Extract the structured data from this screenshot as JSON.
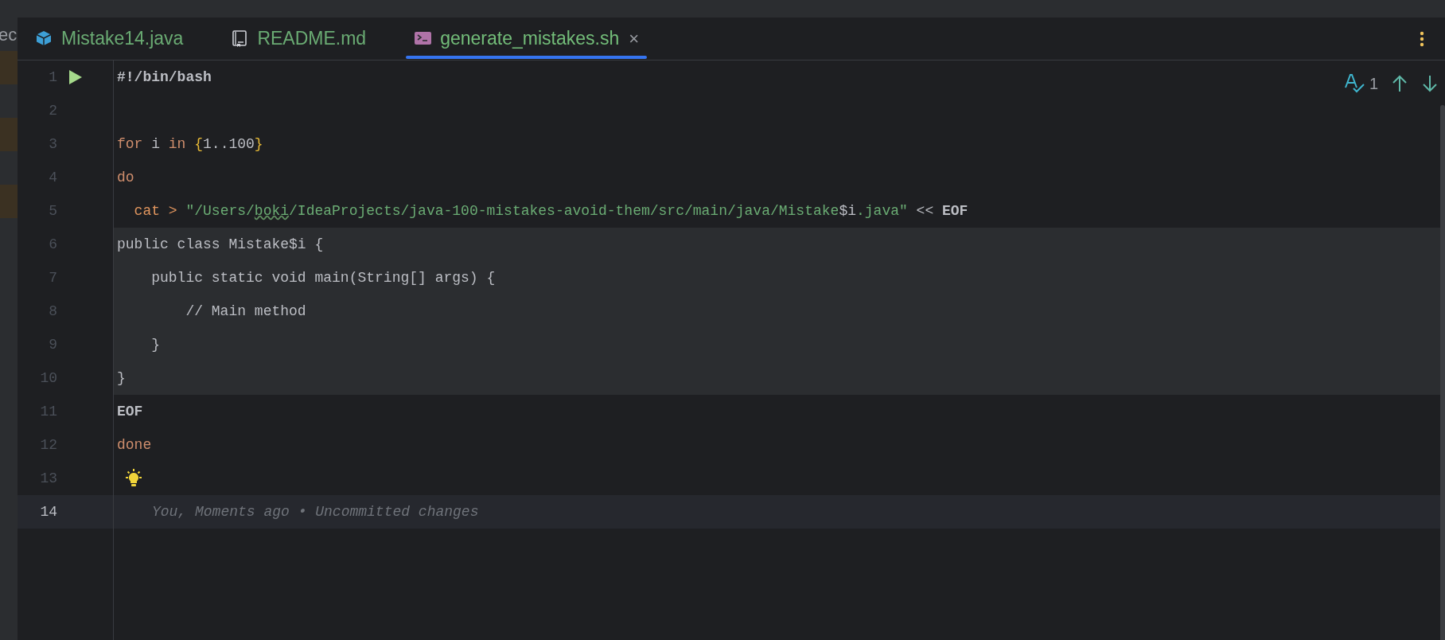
{
  "side_panel": {
    "clipped_text": "ec"
  },
  "tabs": [
    {
      "label": "Mistake14.java",
      "kind": "java",
      "selected": false
    },
    {
      "label": "README.md",
      "kind": "markdown",
      "selected": false
    },
    {
      "label": "generate_mistakes.sh",
      "kind": "shell",
      "selected": true,
      "close_glyph": "×"
    }
  ],
  "inspections": {
    "count": "1"
  },
  "lines": [
    {
      "number": "1",
      "run_marker": true,
      "tokens": [
        {
          "kind": "bold",
          "text": "#!/bin/bash"
        }
      ]
    },
    {
      "number": "2"
    },
    {
      "number": "3",
      "tokens": [
        {
          "kind": "keyword",
          "text": "for"
        },
        {
          "kind": "plain",
          "text": " i "
        },
        {
          "kind": "keyword",
          "text": "in"
        },
        {
          "kind": "brace",
          "text": " {"
        },
        {
          "kind": "plain",
          "text": "1..100"
        },
        {
          "kind": "brace",
          "text": "}"
        }
      ]
    },
    {
      "number": "4",
      "tokens": [
        {
          "kind": "keyword",
          "text": "do"
        }
      ]
    },
    {
      "number": "5",
      "tokens": [
        {
          "kind": "command",
          "text": "  cat > "
        },
        {
          "kind": "string",
          "text": "\"/Users/"
        },
        {
          "kind": "typo",
          "text": "boki"
        },
        {
          "kind": "string",
          "text": "/IdeaProjects/java-100-mistakes-avoid-them/src/main/java/Mistake"
        },
        {
          "kind": "plain",
          "text": "$i"
        },
        {
          "kind": "string",
          "text": ".java\""
        },
        {
          "kind": "plain",
          "text": " << "
        },
        {
          "kind": "bold",
          "text": "EOF"
        }
      ]
    },
    {
      "number": "6",
      "injected": true,
      "tokens": [
        {
          "kind": "plain",
          "text": "public class Mistake$i {"
        }
      ]
    },
    {
      "number": "7",
      "injected": true,
      "tokens": [
        {
          "kind": "plain",
          "text": "    public static void main(String[] args) {"
        }
      ]
    },
    {
      "number": "8",
      "injected": true,
      "tokens": [
        {
          "kind": "plain",
          "text": "        // Main method"
        }
      ]
    },
    {
      "number": "9",
      "injected": true,
      "tokens": [
        {
          "kind": "plain",
          "text": "    }"
        }
      ]
    },
    {
      "number": "10",
      "injected": true,
      "tokens": [
        {
          "kind": "plain",
          "text": "}"
        }
      ]
    },
    {
      "number": "11",
      "tokens": [
        {
          "kind": "bold",
          "text": "EOF"
        }
      ]
    },
    {
      "number": "12",
      "tokens": [
        {
          "kind": "keyword",
          "text": "done"
        }
      ]
    },
    {
      "number": "13",
      "bulb": true
    },
    {
      "number": "14",
      "current": true,
      "annotation": "You, Moments ago • Uncommitted changes"
    }
  ]
}
